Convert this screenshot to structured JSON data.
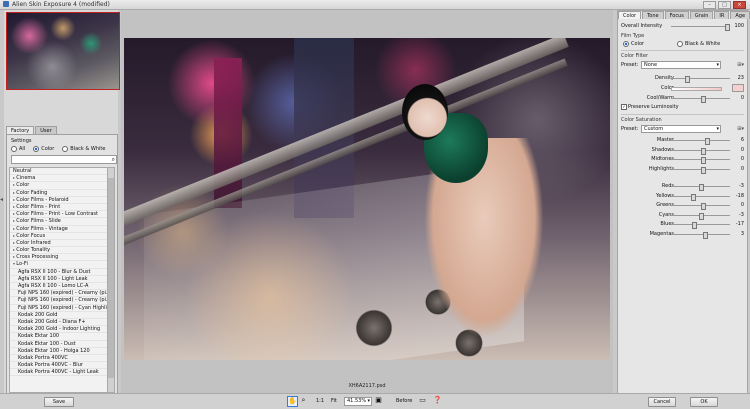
{
  "window": {
    "title": "Alien Skin Exposure 4 (modified)",
    "min": "–",
    "max": "□",
    "close": "×"
  },
  "left": {
    "tabs": [
      "Factory",
      "User"
    ],
    "settings_label": "Settings",
    "filter": [
      "All",
      "Color",
      "Black & White"
    ],
    "search_placeholder": "",
    "presets": [
      {
        "label": "Neutral",
        "kind": "plain"
      },
      {
        "label": "Cinema",
        "kind": "cat"
      },
      {
        "label": "Color",
        "kind": "cat"
      },
      {
        "label": "Color Fading",
        "kind": "cat"
      },
      {
        "label": "Color Films - Polaroid",
        "kind": "cat"
      },
      {
        "label": "Color Films - Print",
        "kind": "cat"
      },
      {
        "label": "Color Films - Print - Low Contrast",
        "kind": "cat"
      },
      {
        "label": "Color Films - Slide",
        "kind": "cat"
      },
      {
        "label": "Color Films - Vintage",
        "kind": "cat"
      },
      {
        "label": "Color Focus",
        "kind": "cat"
      },
      {
        "label": "Color Infrared",
        "kind": "cat"
      },
      {
        "label": "Color Tonality",
        "kind": "cat"
      },
      {
        "label": "Cross Processing",
        "kind": "cat"
      },
      {
        "label": "Lo-Fi",
        "kind": "open"
      },
      {
        "label": "Agfa RSX II 100 - Blur & Dust",
        "kind": "sub"
      },
      {
        "label": "Agfa RSX II 100 - Light Leak",
        "kind": "sub"
      },
      {
        "label": "Agfa RSX II 100 - Lomo LC-A",
        "kind": "sub"
      },
      {
        "label": "Fuji NPS 160 (expired) - Creamy (pi...",
        "kind": "sub"
      },
      {
        "label": "Fuji NPS 160 (expired) - Creamy (pi...",
        "kind": "sub"
      },
      {
        "label": "Fuji NPS 160 (expired) - Cyan Highli...",
        "kind": "sub"
      },
      {
        "label": "Kodak 200 Gold",
        "kind": "sub"
      },
      {
        "label": "Kodak 200 Gold - Diana F+",
        "kind": "sub"
      },
      {
        "label": "Kodak 200 Gold - Indoor Lighting",
        "kind": "sub"
      },
      {
        "label": "Kodak Ektar 100",
        "kind": "sub"
      },
      {
        "label": "Kodak Ektar 100 - Dust",
        "kind": "sub"
      },
      {
        "label": "Kodak Ektar 100 - Holga 120",
        "kind": "sub"
      },
      {
        "label": "Kodak Portra 400VC",
        "kind": "sub"
      },
      {
        "label": "Kodak Portra 400VC - Blur",
        "kind": "sub"
      },
      {
        "label": "Kodak Portra 400VC - Light Leak",
        "kind": "sub"
      }
    ]
  },
  "center": {
    "filename": "XH6A2117.psd"
  },
  "right": {
    "tabs": [
      "Color",
      "Tone",
      "Focus",
      "Grain",
      "IR",
      "Age"
    ],
    "overall_intensity": {
      "label": "Overall Intensity",
      "value": "100"
    },
    "film_type": {
      "label": "Film Type",
      "options": [
        "Color",
        "Black & White"
      ]
    },
    "color_filter": {
      "section": "Color Filter",
      "preset_label": "Preset:",
      "preset_value": "None",
      "density_label": "Density",
      "density_value": "23",
      "color_label": "Color",
      "coolwarm_label": "Cool/Warm",
      "coolwarm_value": "0",
      "preserve_label": "Preserve Luminosity"
    },
    "color_saturation": {
      "section": "Color Saturation",
      "preset_label": "Preset:",
      "preset_value": "Custom",
      "sliders": [
        {
          "label": "Master",
          "value": "6"
        },
        {
          "label": "Shadows",
          "value": "0"
        },
        {
          "label": "Midtones",
          "value": "0"
        },
        {
          "label": "Highlights",
          "value": "0"
        },
        {
          "label": "Reds",
          "value": "-3"
        },
        {
          "label": "Yellows",
          "value": "-18"
        },
        {
          "label": "Greens",
          "value": "0"
        },
        {
          "label": "Cyans",
          "value": "-3"
        },
        {
          "label": "Blues",
          "value": "-17"
        },
        {
          "label": "Magentas",
          "value": "3"
        }
      ]
    }
  },
  "bottom": {
    "save": "Save",
    "zoom_ratio": "1:1",
    "fit": "Fit",
    "zoom": "41.53%",
    "before": "Before",
    "cancel": "Cancel",
    "ok": "OK"
  }
}
